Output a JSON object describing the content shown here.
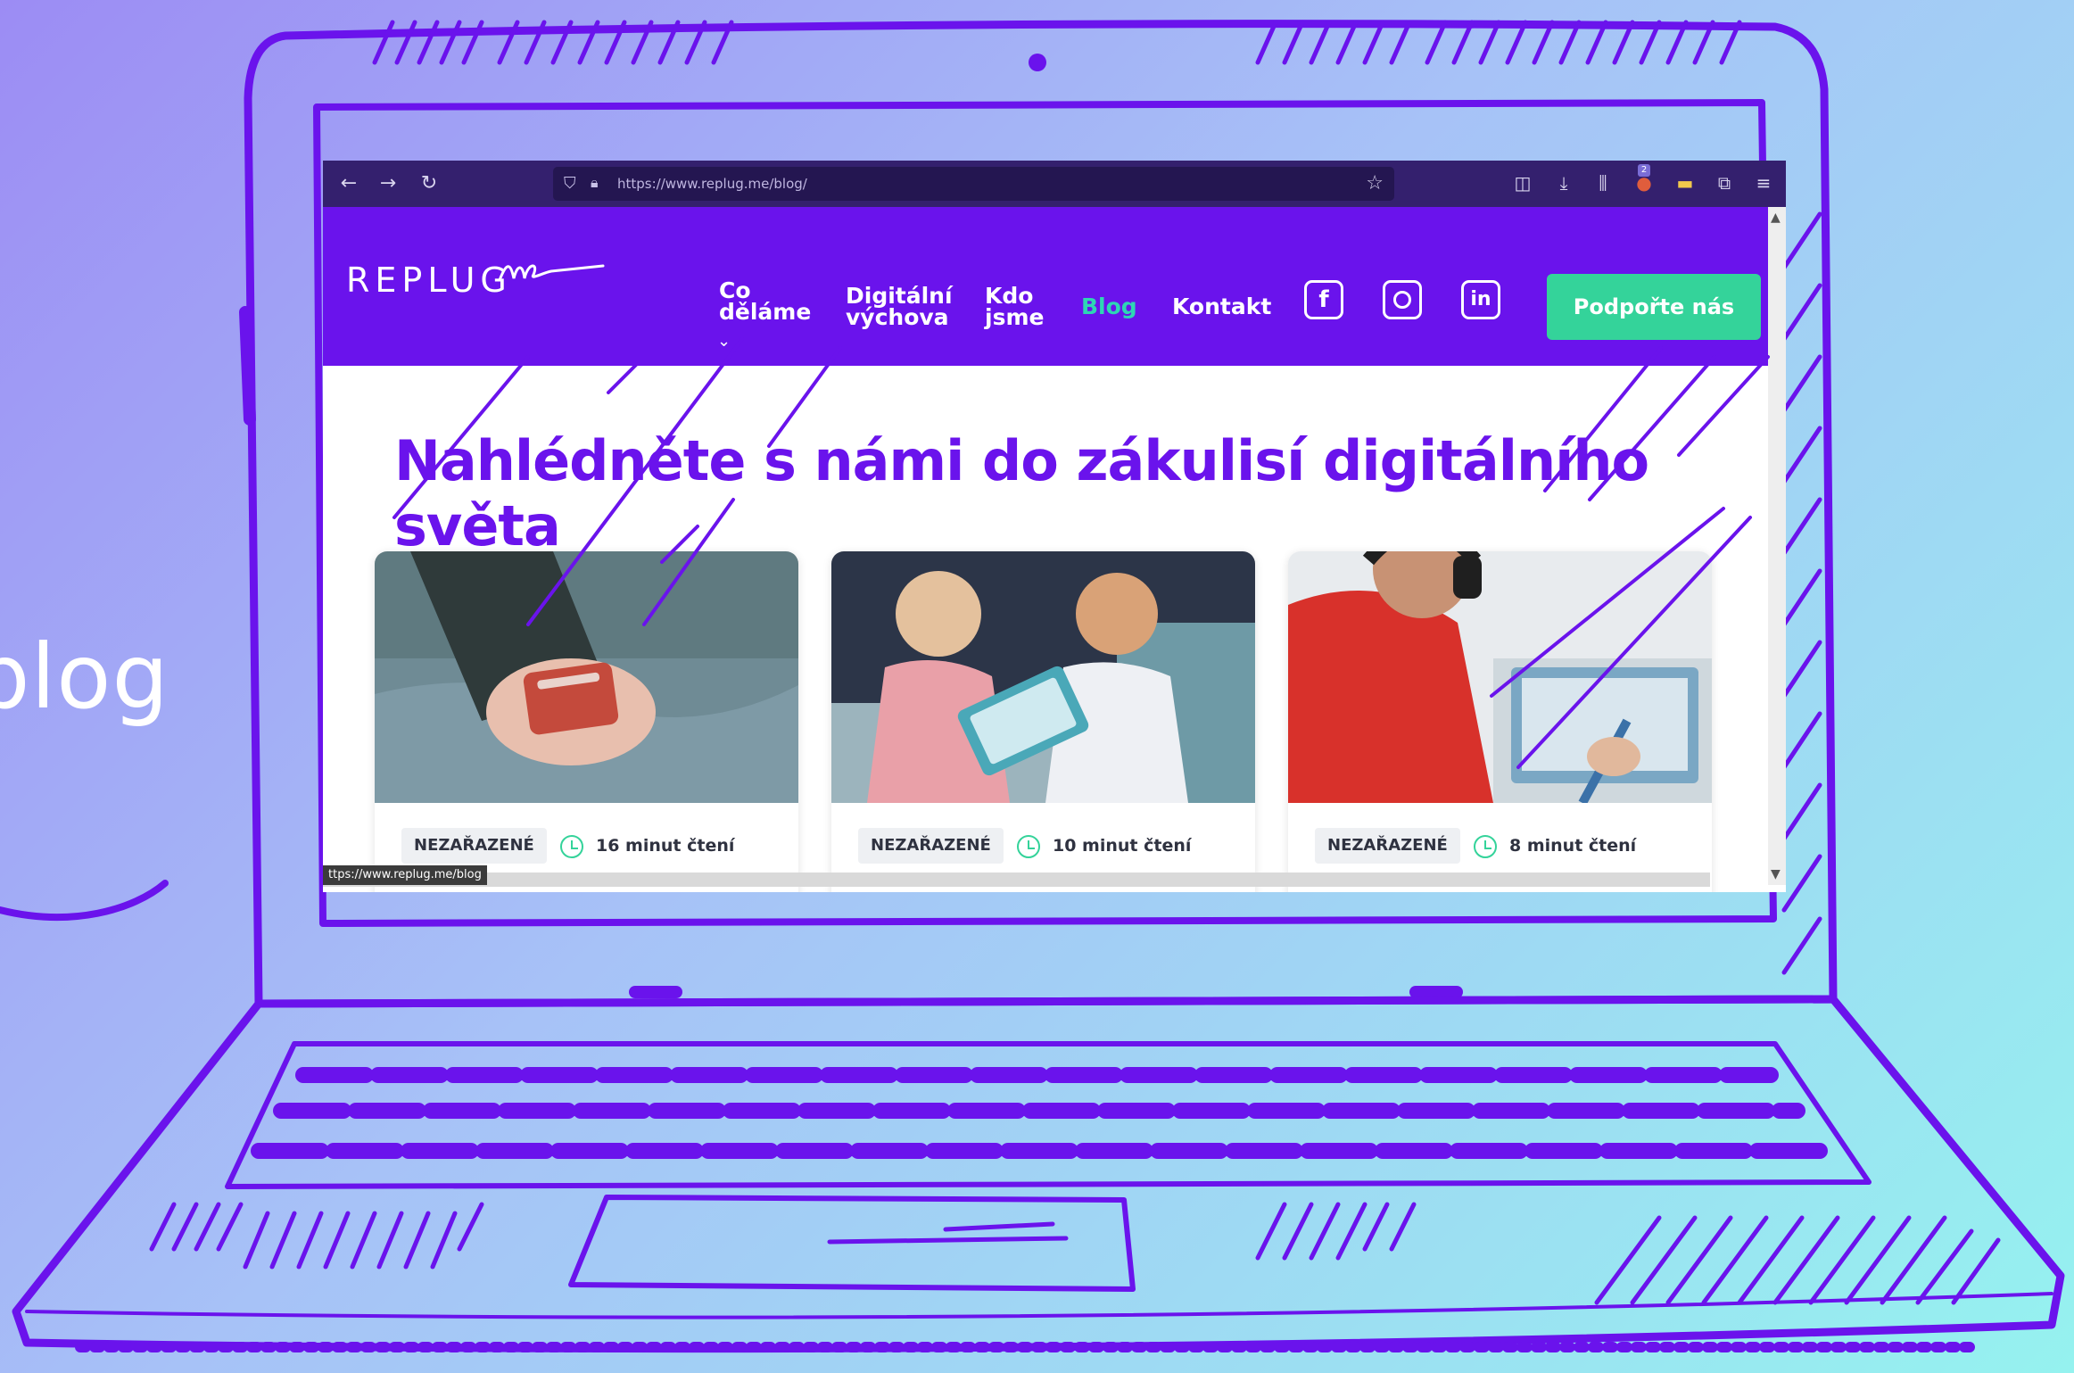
{
  "side_text": "blog",
  "browser": {
    "back_icon": "arrow-left-icon",
    "forward_icon": "arrow-right-icon",
    "reload_icon": "reload-icon",
    "url": "https://www.replug.me/blog/",
    "toolbar_badge": "2",
    "status_url": "ttps://www.replug.me/blog"
  },
  "site": {
    "logo": "REPLUG",
    "nav": [
      {
        "label_line1": "Co",
        "label_line2": "děláme"
      },
      {
        "label_line1": "Digitální",
        "label_line2": "výchova"
      },
      {
        "label_line1": "Kdo",
        "label_line2": "jsme"
      },
      {
        "label": "Blog"
      },
      {
        "label": "Kontakt"
      }
    ],
    "social": [
      "facebook-icon",
      "instagram-icon",
      "linkedin-icon"
    ],
    "cta": "Podpořte nás",
    "headline": "Nahlédněte s námi do zákulisí digitálního světa"
  },
  "cards": [
    {
      "tag": "NEZAŘAZENÉ",
      "read_time": "16 minut čtení",
      "image": "phone-in-hands"
    },
    {
      "tag": "NEZAŘAZENÉ",
      "read_time": "10 minut čtení",
      "image": "toddlers-with-tablet"
    },
    {
      "tag": "NEZAŘAZENÉ",
      "read_time": "8 minut čtení",
      "image": "kid-with-headphones"
    }
  ],
  "colors": {
    "brand_purple": "#6a13ec",
    "accent_green": "#34d39a",
    "active_nav": "#2ed6b4",
    "sketch_stroke": "#6a13ec"
  }
}
